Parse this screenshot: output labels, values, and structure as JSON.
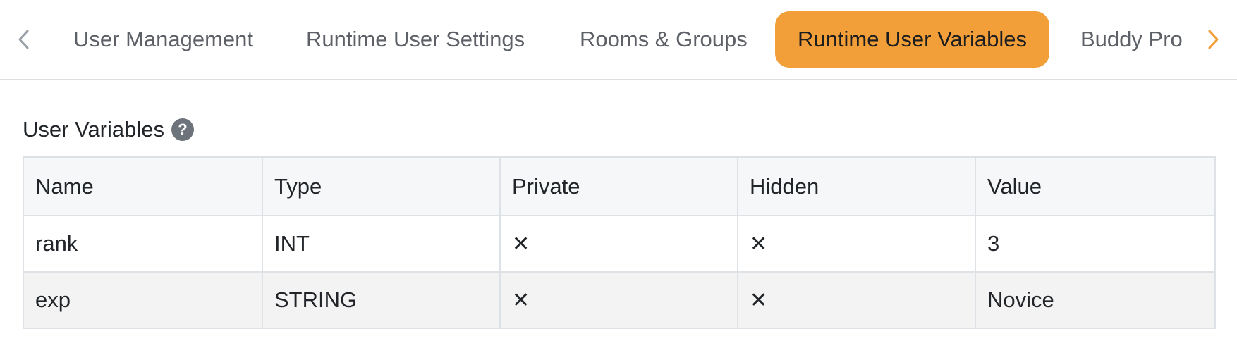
{
  "tabs": {
    "items": [
      {
        "label": "User Management",
        "active": false
      },
      {
        "label": "Runtime User Settings",
        "active": false
      },
      {
        "label": "Rooms & Groups",
        "active": false
      },
      {
        "label": "Runtime User Variables",
        "active": true
      },
      {
        "label": "Buddy Pro",
        "active": false
      }
    ],
    "scroll_left_icon": "chevron-left-icon",
    "scroll_right_icon": "chevron-right-icon"
  },
  "section": {
    "title": "User Variables",
    "help_icon_glyph": "?"
  },
  "table": {
    "headers": [
      "Name",
      "Type",
      "Private",
      "Hidden",
      "Value"
    ],
    "rows": [
      {
        "name": "rank",
        "type": "INT",
        "private": "✕",
        "hidden": "✕",
        "value": "3"
      },
      {
        "name": "exp",
        "type": "STRING",
        "private": "✕",
        "hidden": "✕",
        "value": "Novice"
      }
    ]
  },
  "colors": {
    "accent": "#f29f3a",
    "chevron_left": "#9aa0a6",
    "chevron_right": "#f29f3a"
  }
}
